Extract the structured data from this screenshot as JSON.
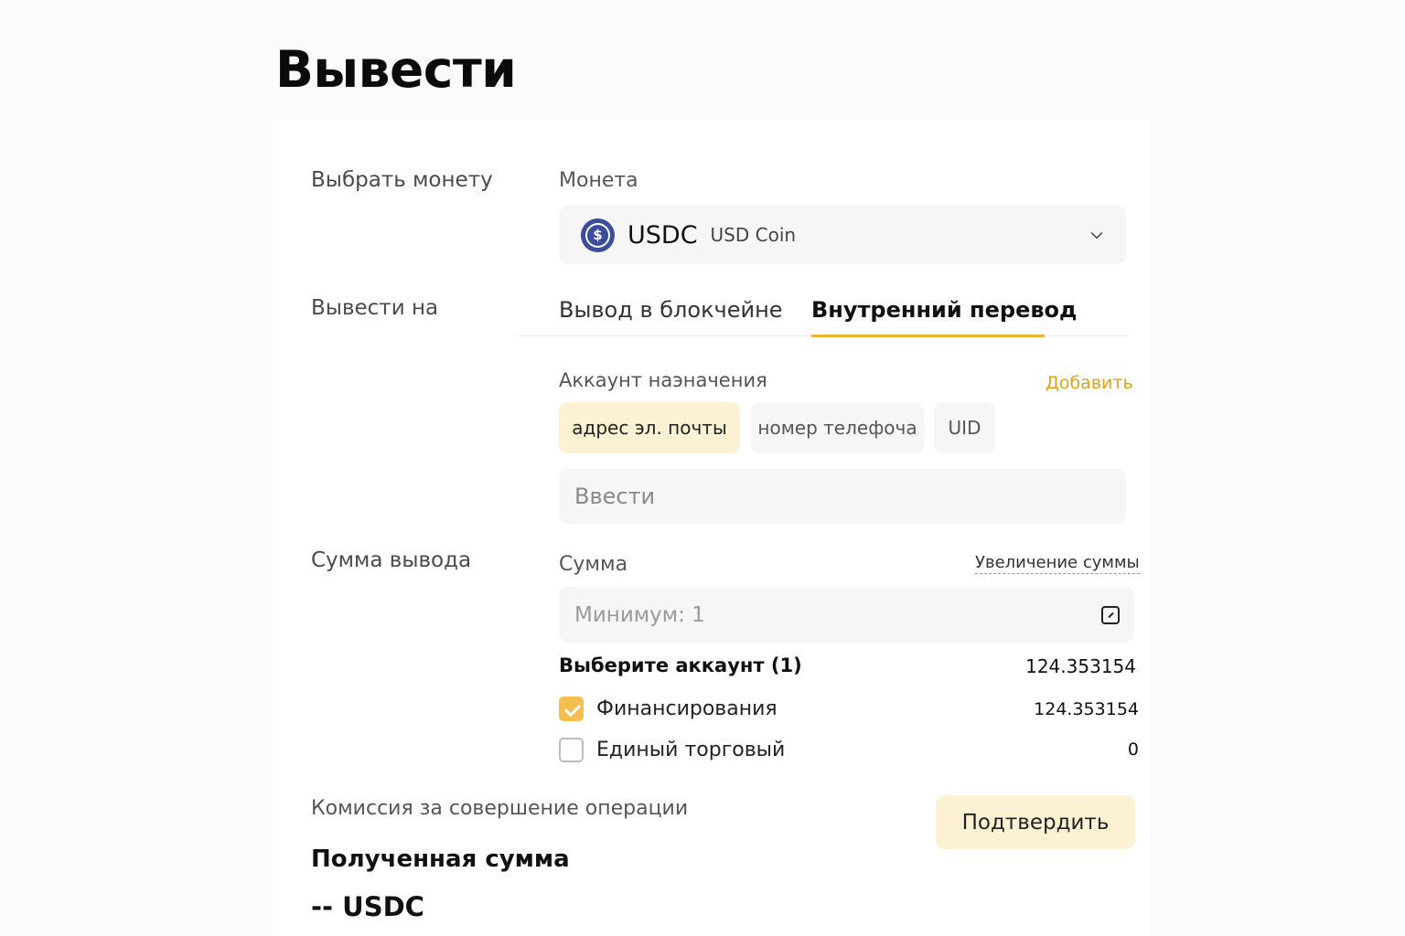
{
  "page": {
    "title": "Вывести"
  },
  "coin_section": {
    "left_label": "Выбрать монету",
    "field_label": "Монета",
    "selected": {
      "code": "USDC",
      "name": "USD Coin",
      "icon": "usdc-coin-icon",
      "icon_color": "#3c4d9c"
    }
  },
  "withdraw_to": {
    "left_label": "Вывести на",
    "tabs": [
      {
        "label": "Вывод в блокчейне",
        "active": false
      },
      {
        "label": "Внутренний перевод",
        "active": true
      }
    ],
    "accent_color": "#e9b233"
  },
  "destination": {
    "label": "Аккаунт наэначения",
    "add_link": "Добавить",
    "chips": [
      {
        "label": "адрес эл. почты",
        "active": true
      },
      {
        "label": "номер телефоча",
        "active": false
      },
      {
        "label": "UID",
        "active": false
      }
    ],
    "input_placeholder": "Ввести"
  },
  "amount": {
    "left_label": "Сумма вывода",
    "field_label": "Сумма",
    "increase_link": "Увеличение суммы",
    "input_placeholder": "Минимум: 1",
    "accounts_title": "Выберите аккаунт (1)",
    "accounts_total": "124.353154",
    "accounts": [
      {
        "label": "Финансирования",
        "value": "124.353154",
        "checked": true
      },
      {
        "label": "Единый торговый",
        "value": "0",
        "checked": false
      }
    ]
  },
  "footer": {
    "fee_label": "Комиссия за совершение операции",
    "confirm_label": "Подтвердить",
    "received_title": "Полученная сумма",
    "received_value": "-- USDC"
  }
}
